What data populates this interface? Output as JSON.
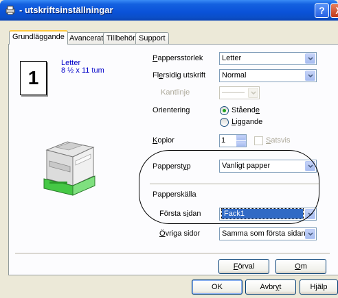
{
  "window": {
    "title": "- utskriftsinställningar",
    "help_label": "?",
    "close_label": "X"
  },
  "tabs": [
    {
      "label": "Grundläggande",
      "active": true
    },
    {
      "label": "Avancerat",
      "active": false
    },
    {
      "label": "Tillbehör",
      "active": false
    },
    {
      "label": "Support",
      "active": false
    }
  ],
  "preview": {
    "number": "1",
    "paper": "Letter",
    "size": "8 ½ x 11 tum"
  },
  "settings": {
    "paper_size": {
      "label_prefix": "P",
      "label_rest": "appersstorlek",
      "value": "Letter"
    },
    "multipage": {
      "label_pre": "Fl",
      "label_u": "e",
      "label_post": "rsidig utskrift",
      "value": "Normal"
    },
    "border": {
      "label": "Kantlinje",
      "value": "———"
    },
    "orientation": {
      "label": "Orientering",
      "portrait_pre": "Ståend",
      "portrait_u": "e",
      "landscape_u": "L",
      "landscape_post": "iggande"
    },
    "copies": {
      "label_u": "K",
      "label_post": "opior",
      "value": "1",
      "collate_u": "S",
      "collate_post": "atsvis"
    },
    "paper_type": {
      "label_pre": "Papperst",
      "label_u": "y",
      "label_post": "p",
      "value": "Vanligt papper"
    },
    "paper_source": {
      "label": "Papperskälla"
    },
    "first_page": {
      "label_pre": "Första s",
      "label_u": "i",
      "label_post": "dan",
      "value": "Fack1"
    },
    "other_pages": {
      "label_u": "Ö",
      "label_post": "vriga sidor",
      "value": "Samma som första sidan"
    }
  },
  "panel_buttons": {
    "default_u": "F",
    "default_post": "örval",
    "about_u": "O",
    "about_post": "m"
  },
  "dialog_buttons": {
    "ok": "OK",
    "cancel_pre": "Avbr",
    "cancel_u": "y",
    "cancel_post": "t",
    "help": "Hjälp"
  },
  "colors": {
    "titlebar": "#0a52d8",
    "selection": "#316ac5",
    "tab_highlight": "#ffc83c"
  }
}
